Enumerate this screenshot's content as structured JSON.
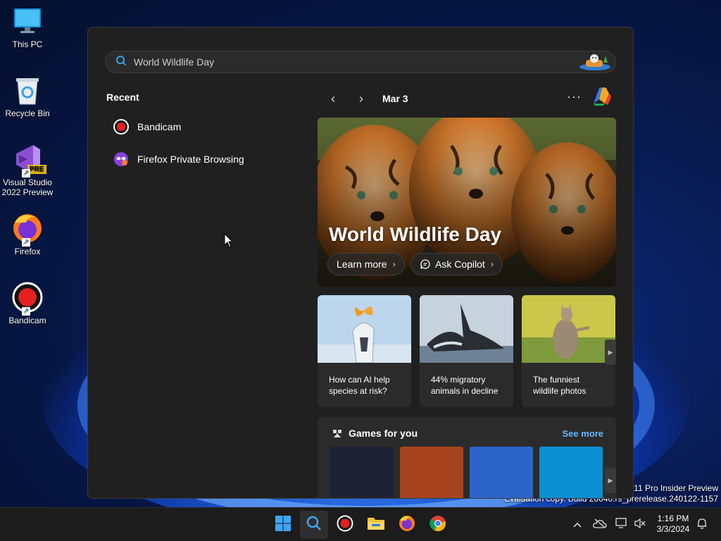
{
  "desktop": {
    "icons": [
      {
        "label": "This PC",
        "icon": "monitor-icon"
      },
      {
        "label": "Recycle Bin",
        "icon": "recycle-bin-icon"
      },
      {
        "label": "Visual Studio 2022 Preview",
        "icon": "visual-studio-icon",
        "badge": "PRE"
      },
      {
        "label": "Firefox",
        "icon": "firefox-icon"
      },
      {
        "label": "Bandicam",
        "icon": "bandicam-icon"
      }
    ],
    "watermark": {
      "line1": "s 11 Pro Insider Preview",
      "line2": "Evaluation copy. Build 26040.rs_prerelease.240122-1157"
    }
  },
  "search": {
    "value": "World Wildlife Day",
    "placeholder": "World Wildlife Day",
    "icon": "search-icon"
  },
  "recent": {
    "heading": "Recent",
    "items": [
      {
        "label": "Bandicam",
        "icon": "bandicam-icon"
      },
      {
        "label": "Firefox Private Browsing",
        "icon": "firefox-private-icon"
      }
    ]
  },
  "highlights": {
    "date": "Mar 3",
    "more": "···",
    "hero": {
      "title": "World Wildlife Day",
      "learn_more": "Learn more",
      "ask_copilot": "Ask Copilot"
    },
    "cards": [
      {
        "text": "How can AI help species at risk?"
      },
      {
        "text": "44% migratory animals in decline"
      },
      {
        "text": "The funniest wildlife photos"
      }
    ]
  },
  "games": {
    "heading": "Games for you",
    "see_more": "See more",
    "tile_colors": [
      "#1d2233",
      "#a8431f",
      "#2c65c9",
      "#0a8fd0"
    ]
  },
  "taskbar": {
    "apps": [
      "start-icon",
      "search-icon",
      "bandicam-icon",
      "file-explorer-icon",
      "firefox-icon",
      "chrome-icon"
    ],
    "clock_time": "1:16 PM",
    "clock_date": "3/3/2024"
  },
  "colors": {
    "accent": "#60b8ff",
    "panel": "#202020",
    "card": "#2b2b2b"
  }
}
